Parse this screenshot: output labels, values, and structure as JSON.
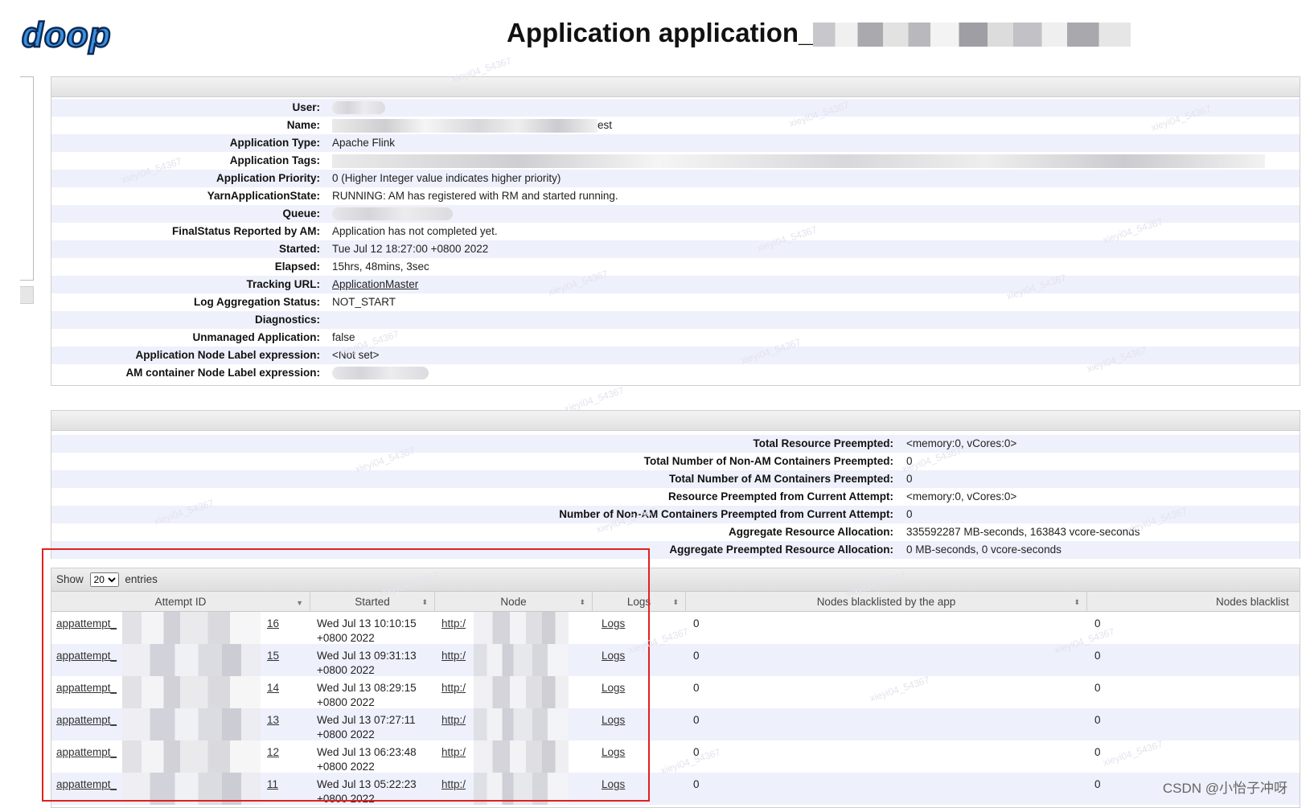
{
  "header": {
    "logo_text": "doop",
    "title": "Application application_"
  },
  "app_info": [
    {
      "key": "User:",
      "value": ""
    },
    {
      "key": "Name:",
      "value": "est"
    },
    {
      "key": "Application Type:",
      "value": "Apache Flink"
    },
    {
      "key": "Application Tags:",
      "value": ""
    },
    {
      "key": "Application Priority:",
      "value": "0 (Higher Integer value indicates higher priority)"
    },
    {
      "key": "YarnApplicationState:",
      "value": "RUNNING: AM has registered with RM and started running."
    },
    {
      "key": "Queue:",
      "value": ""
    },
    {
      "key": "FinalStatus Reported by AM:",
      "value": "Application has not completed yet."
    },
    {
      "key": "Started:",
      "value": "Tue Jul 12 18:27:00 +0800 2022"
    },
    {
      "key": "Elapsed:",
      "value": "15hrs, 48mins, 3sec"
    },
    {
      "key": "Tracking URL:",
      "value": "ApplicationMaster"
    },
    {
      "key": "Log Aggregation Status:",
      "value": "NOT_START"
    },
    {
      "key": "Diagnostics:",
      "value": ""
    },
    {
      "key": "Unmanaged Application:",
      "value": "false"
    },
    {
      "key": "Application Node Label expression:",
      "value": "<Not set>"
    },
    {
      "key": "AM container Node Label expression:",
      "value": ""
    }
  ],
  "resources": [
    {
      "key": "Total Resource Preempted:",
      "value": "<memory:0, vCores:0>"
    },
    {
      "key": "Total Number of Non-AM Containers Preempted:",
      "value": "0"
    },
    {
      "key": "Total Number of AM Containers Preempted:",
      "value": "0"
    },
    {
      "key": "Resource Preempted from Current Attempt:",
      "value": "<memory:0, vCores:0>"
    },
    {
      "key": "Number of Non-AM Containers Preempted from Current Attempt:",
      "value": "0"
    },
    {
      "key": "Aggregate Resource Allocation:",
      "value": "335592287 MB-seconds, 163843 vcore-seconds"
    },
    {
      "key": "Aggregate Preempted Resource Allocation:",
      "value": "0 MB-seconds, 0 vcore-seconds"
    }
  ],
  "attempts_table": {
    "show_label": "Show",
    "page_size": "20",
    "entries_label": "entries",
    "columns": [
      "Attempt ID",
      "Started",
      "Node",
      "Logs",
      "Nodes blacklisted by the app",
      "Nodes blacklist"
    ],
    "rows": [
      {
        "id_prefix": "appattempt_",
        "id_suffix": "16",
        "started_1": "Wed Jul 13 10:10:15",
        "started_2": "+0800 2022",
        "node": "http:/",
        "logs": "Logs",
        "bl_app": "0",
        "bl_sys": "0"
      },
      {
        "id_prefix": "appattempt_",
        "id_suffix": "15",
        "started_1": "Wed Jul 13 09:31:13",
        "started_2": "+0800 2022",
        "node": "http:/",
        "logs": "Logs",
        "bl_app": "0",
        "bl_sys": "0"
      },
      {
        "id_prefix": "appattempt_",
        "id_suffix": "14",
        "started_1": "Wed Jul 13 08:29:15",
        "started_2": "+0800 2022",
        "node": "http:/",
        "logs": "Logs",
        "bl_app": "0",
        "bl_sys": "0"
      },
      {
        "id_prefix": "appattempt_",
        "id_suffix": "13",
        "started_1": "Wed Jul 13 07:27:11",
        "started_2": "+0800 2022",
        "node": "http:/",
        "logs": "Logs",
        "bl_app": "0",
        "bl_sys": "0"
      },
      {
        "id_prefix": "appattempt_",
        "id_suffix": "12",
        "started_1": "Wed Jul 13 06:23:48",
        "started_2": "+0800 2022",
        "node": "http:/",
        "logs": "Logs",
        "bl_app": "0",
        "bl_sys": "0"
      },
      {
        "id_prefix": "appattempt_",
        "id_suffix": "11",
        "started_1": "Wed Jul 13 05:22:23",
        "started_2": "+0800 2022",
        "node": "http:/",
        "logs": "Logs",
        "bl_app": "0",
        "bl_sys": "0"
      }
    ]
  },
  "watermark": "CSDN @小怡子冲呀",
  "colors": {
    "stripe": "#eef0fb",
    "annotation": "#e02020",
    "logo_fill": "#2f7fd0"
  }
}
